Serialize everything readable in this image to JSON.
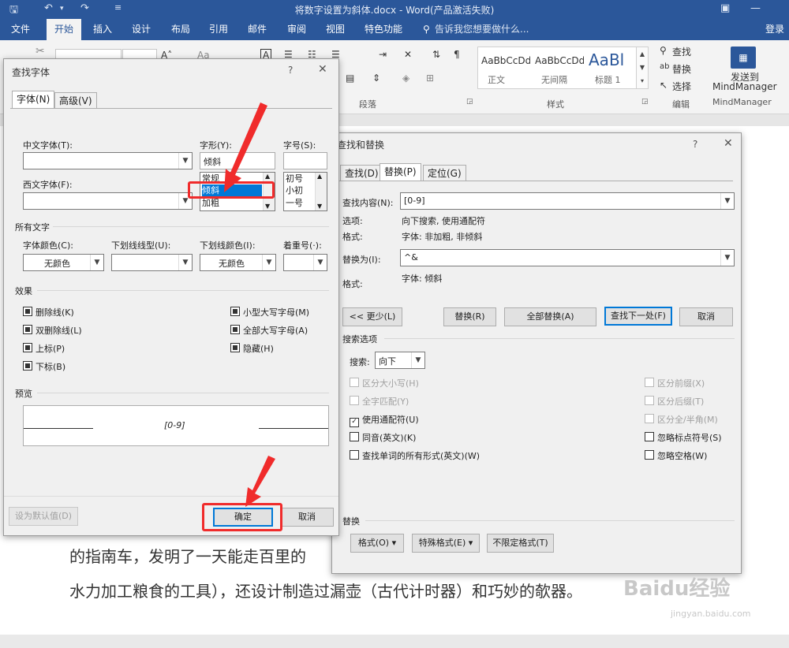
{
  "window": {
    "title": "将数字设置为斜体.docx - Word(产品激活失败)"
  },
  "menu": {
    "tabs": [
      "文件",
      "开始",
      "插入",
      "设计",
      "布局",
      "引用",
      "邮件",
      "审阅",
      "视图",
      "特色功能"
    ],
    "active_tab": "开始",
    "tell_me": "告诉我您想要做什么...",
    "login": "登录"
  },
  "ribbon": {
    "paragraph_group": "段落",
    "styles_group": "样式",
    "styles": [
      {
        "sample": "AaBbCcDd",
        "name": "正文"
      },
      {
        "sample": "AaBbCcDd",
        "name": "无间隔"
      },
      {
        "sample": "AaBl",
        "name": "标题 1"
      }
    ],
    "editing": {
      "find": "查找",
      "replace": "替换",
      "select": "选择",
      "group": "编辑"
    },
    "mindmanager": {
      "send": "发送到",
      "product": "MindManager",
      "group": "MindManager"
    }
  },
  "document": {
    "line1": "的指南车，发明了一天能走百里的",
    "line2": "水力加工粮食的工具），还设计制造过漏壶（古代计时器）和巧妙的欹器。"
  },
  "font_dialog": {
    "title": "查找字体",
    "tabs": [
      "字体(N)",
      "高级(V)"
    ],
    "chinese_font_label": "中文字体(T):",
    "western_font_label": "西文字体(F):",
    "style_label": "字形(Y):",
    "style_value": "倾斜",
    "style_options": [
      "常规",
      "倾斜",
      "加粗"
    ],
    "size_label": "字号(S):",
    "size_options": [
      "初号",
      "小初",
      "一号"
    ],
    "all_text_section": "所有文字",
    "font_color_label": "字体颜色(C):",
    "font_color_value": "无颜色",
    "underline_type_label": "下划线线型(U):",
    "underline_color_label": "下划线颜色(I):",
    "underline_color_value": "无颜色",
    "emphasis_label": "着重号(·):",
    "effects_section": "效果",
    "effects_left": [
      "删除线(K)",
      "双删除线(L)",
      "上标(P)",
      "下标(B)"
    ],
    "effects_right": [
      "小型大写字母(M)",
      "全部大写字母(A)",
      "隐藏(H)"
    ],
    "preview_section": "预览",
    "preview_text": "[0-9]",
    "set_default": "设为默认值(D)",
    "ok": "确定",
    "cancel": "取消"
  },
  "replace_dialog": {
    "title": "查找和替换",
    "tabs": [
      "查找(D)",
      "替换(P)",
      "定位(G)"
    ],
    "find_label": "查找内容(N):",
    "find_value": "[0-9]",
    "options_label": "选项:",
    "options_value": "向下搜索, 使用通配符",
    "format_label": "格式:",
    "find_format": "字体: 非加粗, 非倾斜",
    "replace_label": "替换为(I):",
    "replace_value": "^&",
    "replace_format": "字体: 倾斜",
    "buttons": {
      "less": "<< 更少(L)",
      "replace": "替换(R)",
      "replace_all": "全部替换(A)",
      "find_next": "查找下一处(F)",
      "cancel": "取消"
    },
    "search_options_section": "搜索选项",
    "search_label": "搜索:",
    "search_value": "向下",
    "left_options": [
      "区分大小写(H)",
      "全字匹配(Y)",
      "使用通配符(U)",
      "同音(英文)(K)",
      "查找单词的所有形式(英文)(W)"
    ],
    "right_options": [
      "区分前缀(X)",
      "区分后缀(T)",
      "区分全/半角(M)",
      "忽略标点符号(S)",
      "忽略空格(W)"
    ],
    "replace_section": "替换",
    "format_button": "格式(O)",
    "special_button": "特殊格式(E)",
    "no_format_button": "不限定格式(T)"
  },
  "watermark": {
    "brand": "Baidu经验",
    "url": "jingyan.baidu.com"
  },
  "colors": {
    "word_blue": "#2b579a",
    "annotation_red": "#f02b2b",
    "selection_blue": "#0078d7"
  }
}
